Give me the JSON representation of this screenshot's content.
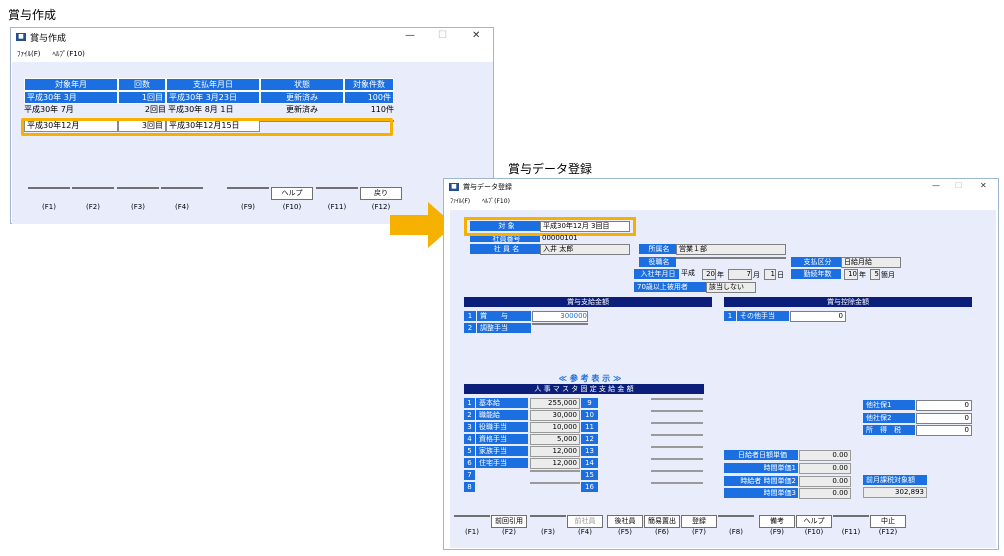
{
  "labels": {
    "left": "賞与作成",
    "right": "賞与データ登録"
  },
  "win1": {
    "title": "賞与作成",
    "menu": [
      "ﾌｧｲﾙ(F)",
      "ﾍﾙﾌﾟ(F10)"
    ],
    "headers": [
      "対象年月",
      "回数",
      "支払年月日",
      "状態",
      "対象件数"
    ],
    "rows": [
      [
        "平成30年 3月",
        "1回目",
        "平成30年 3月23日",
        "更新済み",
        "100件"
      ],
      [
        "平成30年 7月",
        "2回目",
        "平成30年 8月 1日",
        "更新済み",
        "110件"
      ],
      [
        "平成30年12月",
        "3回目",
        "平成30年12月15日",
        "",
        ""
      ]
    ],
    "fbuttons": [
      "",
      "",
      "",
      "",
      "",
      "ヘルプ",
      "",
      "戻り"
    ],
    "fkeys": [
      "(F1)",
      "(F2)",
      "(F3)",
      "(F4)",
      "(F9)",
      "(F10)",
      "(F11)",
      "(F12)"
    ]
  },
  "win2": {
    "title": "賞与データ登録",
    "menu": [
      "ﾌｧｲﾙ(F)",
      "ﾍﾙﾌﾟ(F10)"
    ],
    "target_label": "対 象",
    "target_value": "平成30年12月 3回目",
    "emp_no_label": "社員番号",
    "emp_no": "00000101",
    "emp_name_label": "社 員 名",
    "emp_name": "入井 太郎",
    "dept_label": "所属名",
    "dept": "営業１部",
    "post_label": "役職名",
    "post": "",
    "pay_class_label": "支払区分",
    "pay_class": "日給月給",
    "join_label": "入社年月日",
    "join_era": "平成",
    "join_y": "20",
    "join_y_u": "年",
    "join_m": "7",
    "join_m_u": "月",
    "join_d": "1",
    "join_d_u": "日",
    "tenure_label": "勤続年数",
    "tenure_y": "10",
    "tenure_y_u": "年",
    "tenure_m": "5",
    "tenure_m_u": "箇月",
    "age70_label": "70歳以上被用者",
    "age70": "該当しない",
    "pay_header": "賞与支給金額",
    "pay": [
      {
        "n": "1",
        "label": "賞　　与",
        "value": "300000"
      },
      {
        "n": "2",
        "label": "調整手当",
        "value": ""
      }
    ],
    "ded_header": "賞与控除金額",
    "ded": [
      {
        "n": "1",
        "label": "その他手当",
        "value": "0"
      }
    ],
    "ref_title": "≪ 参 考 表 示 ≫",
    "ref_header": "人 事 マ ス タ 固 定 支 給 金 額",
    "ref_left": [
      {
        "n": "1",
        "label": "基本給",
        "value": "255,000"
      },
      {
        "n": "2",
        "label": "職能給",
        "value": "30,000"
      },
      {
        "n": "3",
        "label": "役職手当",
        "value": "10,000"
      },
      {
        "n": "4",
        "label": "資格手当",
        "value": "5,000"
      },
      {
        "n": "5",
        "label": "家族手当",
        "value": "12,000"
      },
      {
        "n": "6",
        "label": "住宅手当",
        "value": "12,000"
      },
      {
        "n": "7",
        "label": "",
        "value": ""
      },
      {
        "n": "8",
        "label": "",
        "value": ""
      }
    ],
    "ref_right": [
      "9",
      "10",
      "11",
      "12",
      "13",
      "14",
      "15",
      "16"
    ],
    "social": [
      {
        "label": "他社保1",
        "value": "0"
      },
      {
        "label": "他社保2",
        "value": "0"
      },
      {
        "label": "所　得　税",
        "value": "0"
      }
    ],
    "wage": [
      {
        "label": "日給者日額単価",
        "value": "0.00"
      },
      {
        "label": "時間単価1",
        "value": "0.00"
      },
      {
        "label": "時給者 時間単価2",
        "value": "0.00"
      },
      {
        "label": "時間単価3",
        "value": "0.00"
      }
    ],
    "prev_label": "前月課税対象額",
    "prev_value": "302,893",
    "fbuttons": [
      "",
      "前回引用",
      "",
      "前社員",
      "後社員",
      "簡易置出",
      "登録",
      "",
      "備考",
      "ヘルプ",
      "",
      "中止"
    ],
    "fkeys": [
      "(F1)",
      "(F2)",
      "(F3)",
      "(F4)",
      "(F5)",
      "(F6)",
      "(F7)",
      "(F8)",
      "(F9)",
      "(F10)",
      "(F11)",
      "(F12)"
    ]
  },
  "colors": {
    "highlight": "#f5b000",
    "blue": "#1b6fe0",
    "navy": "#0b1e7a"
  }
}
